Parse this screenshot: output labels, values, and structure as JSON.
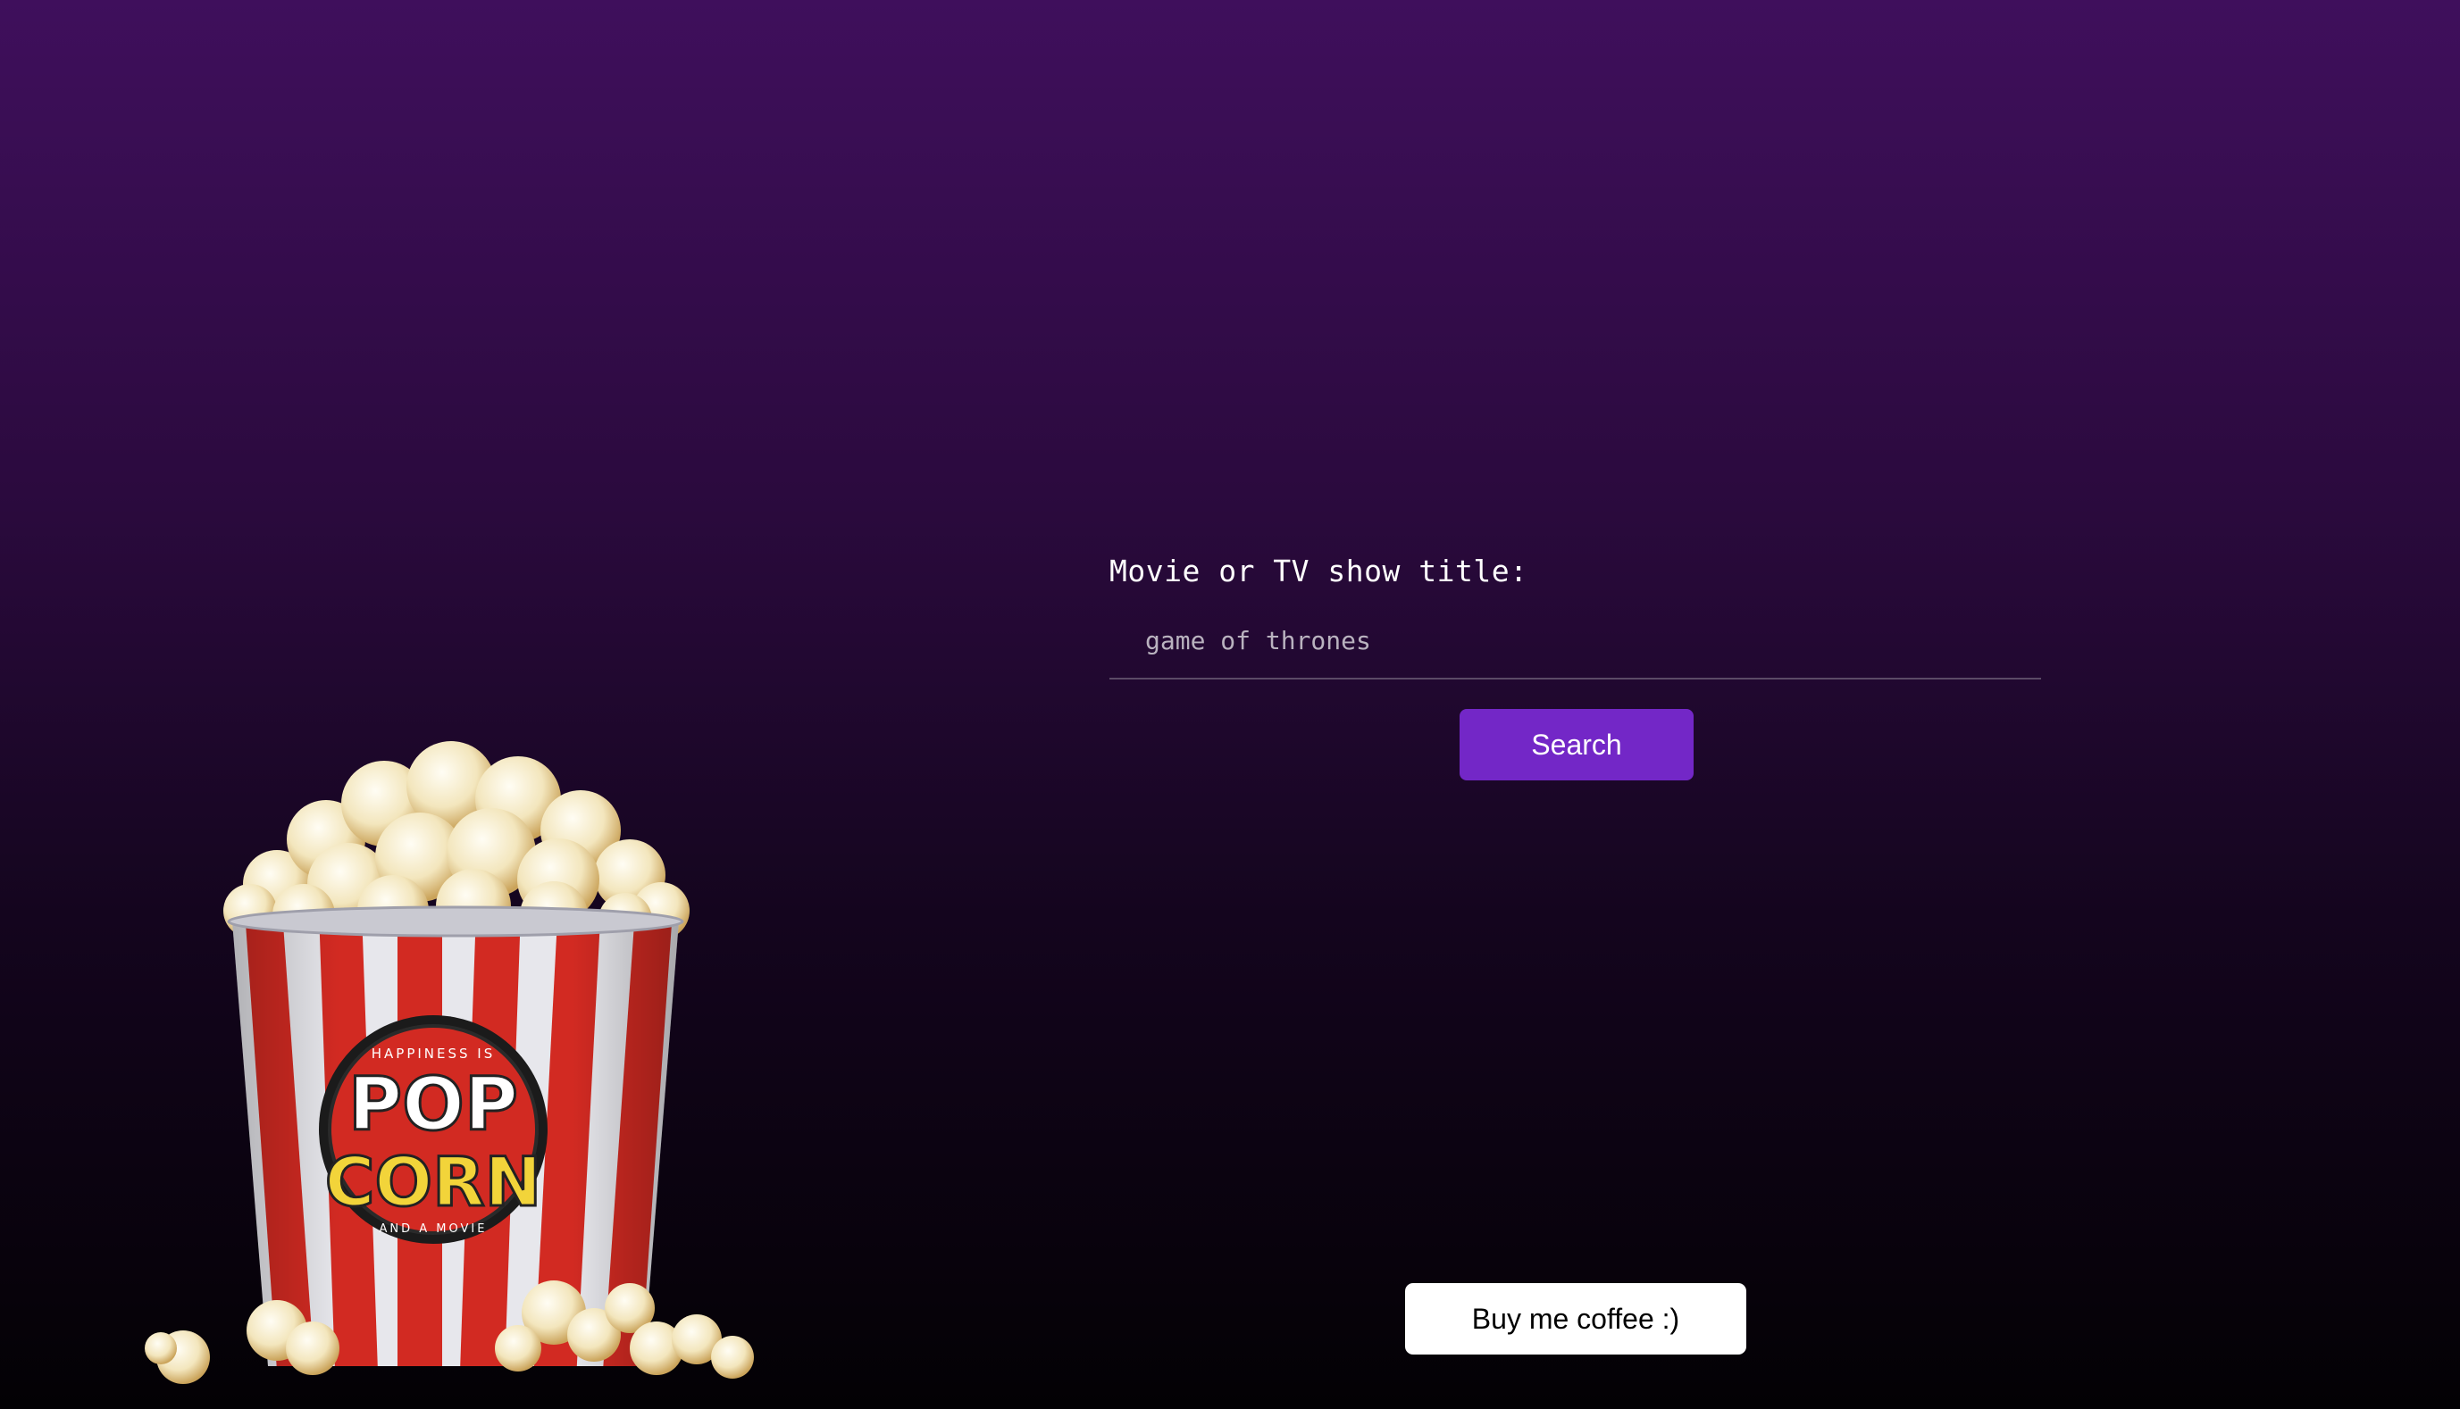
{
  "search_form": {
    "label": "Movie or TV show title:",
    "input_placeholder": "game of thrones",
    "input_value": "",
    "search_button_label": "Search"
  },
  "footer": {
    "coffee_button_label": "Buy me coffee :)"
  },
  "illustration": {
    "name": "popcorn-bucket",
    "logo_text": {
      "top": "HAPPINESS IS",
      "line1": "POP",
      "line2": "CORN",
      "bottom": "AND A MOVIE"
    }
  },
  "colors": {
    "background_top": "#3f0f5c",
    "background_bottom": "#030104",
    "accent": "#7327c7",
    "stripe_red": "#d22a22",
    "logo_yellow": "#f2d43a"
  }
}
